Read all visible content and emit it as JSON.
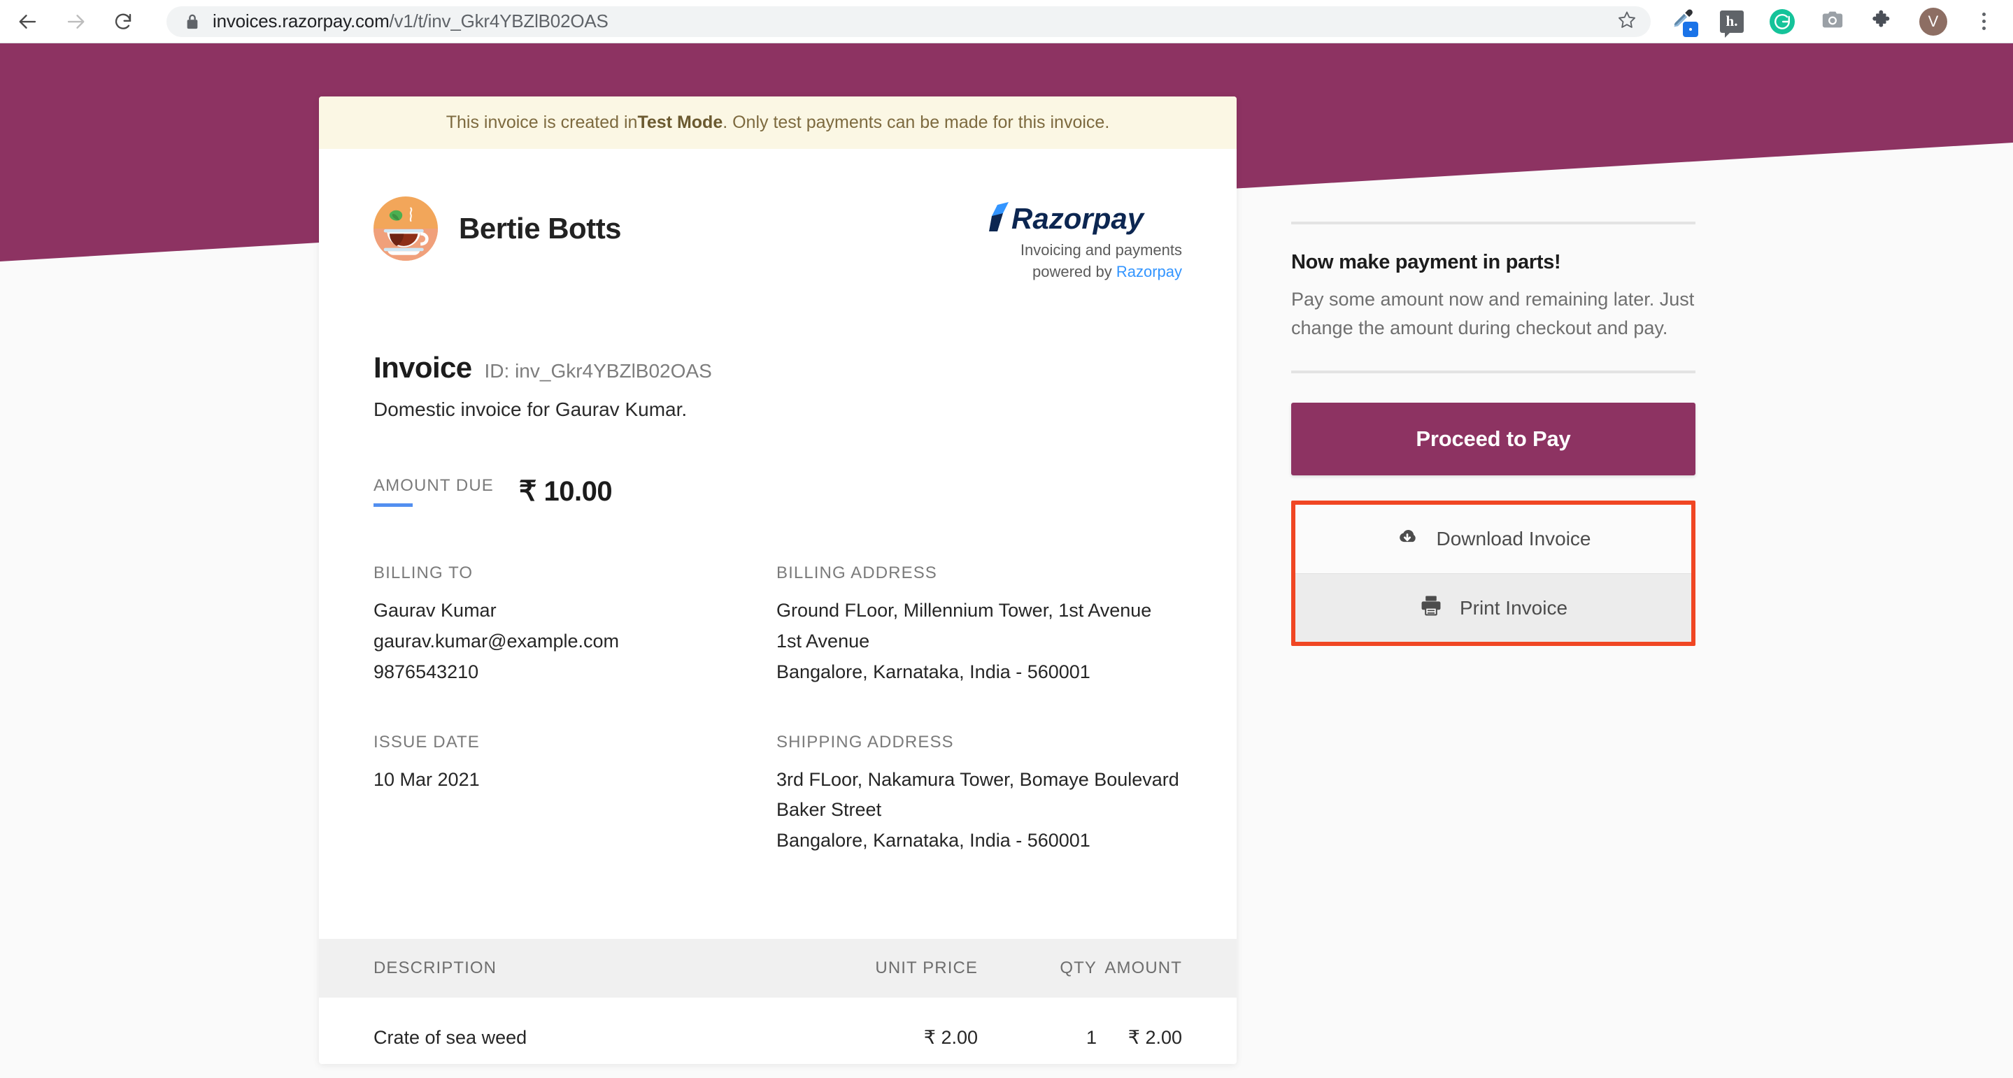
{
  "browser": {
    "back_icon": "back-arrow-icon",
    "forward_icon": "forward-arrow-icon",
    "reload_icon": "reload-icon",
    "lock_icon": "lock-icon",
    "url_host": "invoices.razorpay.com",
    "url_path": "/v1/t/inv_Gkr4YBZlB02OAS",
    "url_full": "invoices.razorpay.com/v1/t/inv_Gkr4YBZlB02OAS",
    "star_icon": "bookmark-star-icon",
    "extensions": [
      {
        "name": "eyedropper-icon",
        "label": "ColorPick Eyedropper"
      },
      {
        "name": "hypothesis-icon",
        "label": "h."
      },
      {
        "name": "grammarly-icon",
        "label": "G"
      },
      {
        "name": "screenshot-camera-icon",
        "label": "Screenshot"
      },
      {
        "name": "extensions-puzzle-icon",
        "label": "Extensions"
      }
    ],
    "avatar_initial": "V",
    "menu_icon": "three-dot-menu-icon"
  },
  "theme": {
    "banner_color": "#8d3362",
    "accent_blue": "#528ff0",
    "highlight_red": "#f04623",
    "test_banner_bg": "#fbf7e4"
  },
  "invoice": {
    "test_mode_notice_pre": "This invoice is created in ",
    "test_mode_strong": "Test Mode",
    "test_mode_notice_post": ". Only test payments can be made for this invoice.",
    "brand_name": "Bertie Botts",
    "brand_logo_icon": "tea-cup-logo-icon",
    "razorpay_wordmark": "Razorpay",
    "razorpay_tagline_line1": "Invoicing and payments",
    "razorpay_tagline_line2_pre": "powered by ",
    "razorpay_tagline_link": "Razorpay",
    "title": "Invoice",
    "id_label": "ID: inv_Gkr4YBZlB02OAS",
    "description": "Domestic invoice for Gaurav Kumar.",
    "amount_due_label": "AMOUNT DUE",
    "amount_due_value": "₹ 10.00",
    "billing_to_label": "BILLING TO",
    "billing_to_name": "Gaurav Kumar",
    "billing_to_email": "gaurav.kumar@example.com",
    "billing_to_phone": "9876543210",
    "billing_address_label": "BILLING ADDRESS",
    "billing_address_line1": "Ground FLoor, Millennium Tower, 1st Avenue",
    "billing_address_line2": "1st Avenue",
    "billing_address_line3": "Bangalore, Karnataka, India - 560001",
    "issue_date_label": "ISSUE DATE",
    "issue_date_value": "10 Mar 2021",
    "shipping_address_label": "SHIPPING ADDRESS",
    "shipping_address_line1": "3rd FLoor, Nakamura Tower, Bomaye Boulevard",
    "shipping_address_line2": "Baker Street",
    "shipping_address_line3": "Bangalore, Karnataka, India - 560001"
  },
  "line_items": {
    "headers": {
      "description": "DESCRIPTION",
      "unit_price": "UNIT PRICE",
      "qty": "QTY",
      "amount": "AMOUNT"
    },
    "rows": [
      {
        "description": "Crate of sea weed",
        "unit_price": "₹ 2.00",
        "qty": "1",
        "amount": "₹ 2.00"
      }
    ]
  },
  "side_panel": {
    "promo_title": "Now make payment in parts!",
    "promo_text": "Pay some amount now and remaining later. Just change the amount during checkout and pay.",
    "pay_button_label": "Proceed to Pay",
    "download_label": "Download Invoice",
    "download_icon": "cloud-download-icon",
    "print_label": "Print Invoice",
    "print_icon": "printer-icon"
  }
}
